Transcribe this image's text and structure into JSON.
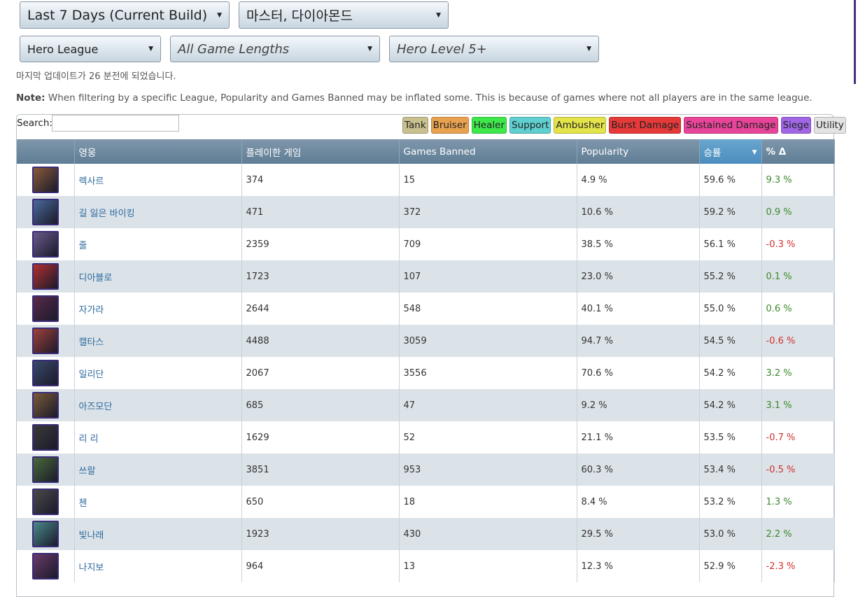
{
  "filters": {
    "build": "Last 7 Days (Current Build)",
    "league_rank": "마스터, 다이아몬드",
    "game_mode": "Hero League",
    "game_length": "All Game Lengths",
    "hero_level": "Hero Level 5+"
  },
  "update_text": "마지막 업데이트가 26 분전에 되었습니다.",
  "note": {
    "label": "Note:",
    "text": " When filtering by a specific League, Popularity and Games Banned may be inflated some. This is because of games where not all players are in the same league."
  },
  "search": {
    "label": "Search:",
    "value": ""
  },
  "roles": [
    {
      "label": "Tank",
      "color": "#c9c08f"
    },
    {
      "label": "Bruiser",
      "color": "#e8a24f"
    },
    {
      "label": "Healer",
      "color": "#3ee84a"
    },
    {
      "label": "Support",
      "color": "#5fcfcf"
    },
    {
      "label": "Ambusher",
      "color": "#e3e34a"
    },
    {
      "label": "Burst Damage",
      "color": "#e63a3a"
    },
    {
      "label": "Sustained Damage",
      "color": "#e8459a"
    },
    {
      "label": "Siege",
      "color": "#a066e6"
    },
    {
      "label": "Utility",
      "color": "#e3e3e3"
    }
  ],
  "table": {
    "headers": {
      "hero": "영웅",
      "games_played": "플레이한 게임",
      "games_banned": "Games Banned",
      "popularity": "Popularity",
      "win_rate": "승률",
      "delta": "% Δ"
    },
    "rows": [
      {
        "name": "렉사르",
        "played": "374",
        "banned": "15",
        "popularity": "4.9 %",
        "win": "59.6 %",
        "delta": "9.3 %",
        "trend": "pos",
        "icon": "rexxar-portrait-icon",
        "color": "#8a5a3a"
      },
      {
        "name": "길 잃은 바이킹",
        "played": "471",
        "banned": "372",
        "popularity": "10.6 %",
        "win": "59.2 %",
        "delta": "0.9 %",
        "trend": "pos",
        "icon": "lost-vikings-portrait-icon",
        "color": "#4a6a9a"
      },
      {
        "name": "줄",
        "played": "2359",
        "banned": "709",
        "popularity": "38.5 %",
        "win": "56.1 %",
        "delta": "-0.3 %",
        "trend": "neg",
        "icon": "kelthuzad-portrait-icon",
        "color": "#6a5a8a"
      },
      {
        "name": "디아블로",
        "played": "1723",
        "banned": "107",
        "popularity": "23.0 %",
        "win": "55.2 %",
        "delta": "0.1 %",
        "trend": "pos",
        "icon": "diablo-portrait-icon",
        "color": "#b03030"
      },
      {
        "name": "자가라",
        "played": "2644",
        "banned": "548",
        "popularity": "40.1 %",
        "win": "55.0 %",
        "delta": "0.6 %",
        "trend": "pos",
        "icon": "zagara-portrait-icon",
        "color": "#5a2a4a"
      },
      {
        "name": "캘타스",
        "played": "4488",
        "banned": "3059",
        "popularity": "94.7 %",
        "win": "54.5 %",
        "delta": "-0.6 %",
        "trend": "neg",
        "icon": "kaelthas-portrait-icon",
        "color": "#a0403a"
      },
      {
        "name": "일리단",
        "played": "2067",
        "banned": "3556",
        "popularity": "70.6 %",
        "win": "54.2 %",
        "delta": "3.2 %",
        "trend": "pos",
        "icon": "illidan-portrait-icon",
        "color": "#3a4a6a"
      },
      {
        "name": "아즈모단",
        "played": "685",
        "banned": "47",
        "popularity": "9.2 %",
        "win": "54.2 %",
        "delta": "3.1 %",
        "trend": "pos",
        "icon": "azmodan-portrait-icon",
        "color": "#7a5a3a"
      },
      {
        "name": "리 리",
        "played": "1629",
        "banned": "52",
        "popularity": "21.1 %",
        "win": "53.5 %",
        "delta": "-0.7 %",
        "trend": "neg",
        "icon": "lili-portrait-icon",
        "color": "#3a3a3a"
      },
      {
        "name": "쓰랄",
        "played": "3851",
        "banned": "953",
        "popularity": "60.3 %",
        "win": "53.4 %",
        "delta": "-0.5 %",
        "trend": "neg",
        "icon": "thrall-portrait-icon",
        "color": "#4a6a3a"
      },
      {
        "name": "첸",
        "played": "650",
        "banned": "18",
        "popularity": "8.4 %",
        "win": "53.2 %",
        "delta": "1.3 %",
        "trend": "pos",
        "icon": "chen-portrait-icon",
        "color": "#4a4a4a"
      },
      {
        "name": "빛나래",
        "played": "1923",
        "banned": "430",
        "popularity": "29.5 %",
        "win": "53.0 %",
        "delta": "2.2 %",
        "trend": "pos",
        "icon": "brightwing-portrait-icon",
        "color": "#4a8a8a"
      },
      {
        "name": "나지보",
        "played": "964",
        "banned": "13",
        "popularity": "12.3 %",
        "win": "52.9 %",
        "delta": "-2.3 %",
        "trend": "neg",
        "icon": "nazeebo-portrait-icon",
        "color": "#6a3a6a"
      }
    ]
  }
}
